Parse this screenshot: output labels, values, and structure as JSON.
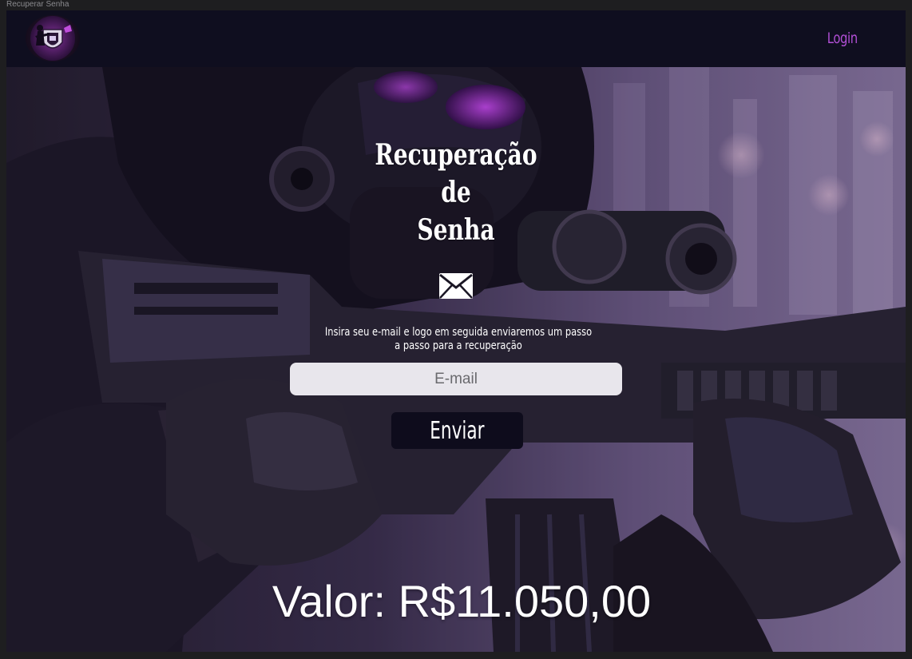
{
  "window": {
    "title": "Recuperar Senha"
  },
  "navbar": {
    "logo_name": "soldier-shield-logo",
    "login_label": "Login"
  },
  "main": {
    "title_line1": "Recuperação",
    "title_line2": "de",
    "title_line3": "Senha",
    "mail_icon": "envelope-icon",
    "instruction": "Insira seu e-mail e logo em seguida enviaremos um passo a passo para a recuperação",
    "email_placeholder": "E-mail",
    "email_value": "",
    "send_label": "Enviar",
    "price_text": "Valor: R$11.050,00"
  },
  "colors": {
    "navbar_bg": "#0f0e1f",
    "accent_purple": "#b24fd6",
    "button_bg": "#0e0c1c",
    "input_bg": "#e8e6ec",
    "text_light": "#ffffff"
  }
}
